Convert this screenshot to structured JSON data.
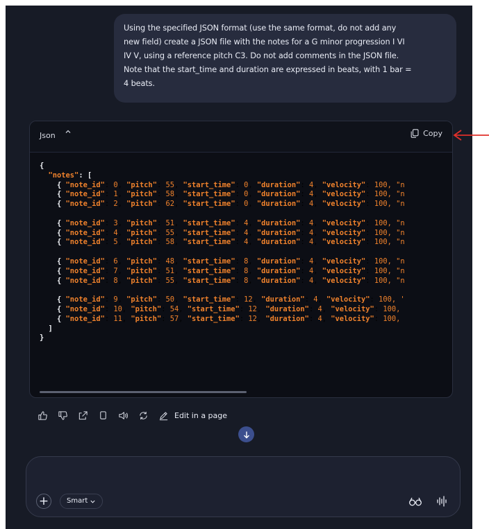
{
  "user_message": "Using the specified JSON format (use the same format, do not add any\nnew field) create a JSON file with the notes for a G minor progression I VI\nIV V, using a reference pitch C3. Do not add comments in the JSON file.\nNote that the start_time and duration are expressed in beats, with 1 bar =\n4 beats.",
  "code_block": {
    "language_label": "Json",
    "copy_label": "Copy",
    "root_open": "{",
    "notes_key": "\"notes\"",
    "notes_open": ": [",
    "groups": [
      [
        {
          "note_id": "0",
          "pitch": "55",
          "start_time": "0",
          "duration": "4",
          "velocity": "100",
          "tail": ", \"n"
        },
        {
          "note_id": "1",
          "pitch": "58",
          "start_time": "0",
          "duration": "4",
          "velocity": "100",
          "tail": ", \"n"
        },
        {
          "note_id": "2",
          "pitch": "62",
          "start_time": "0",
          "duration": "4",
          "velocity": "100",
          "tail": ", \"n"
        }
      ],
      [
        {
          "note_id": "3",
          "pitch": "51",
          "start_time": "4",
          "duration": "4",
          "velocity": "100",
          "tail": ", \"n"
        },
        {
          "note_id": "4",
          "pitch": "55",
          "start_time": "4",
          "duration": "4",
          "velocity": "100",
          "tail": ", \"n"
        },
        {
          "note_id": "5",
          "pitch": "58",
          "start_time": "4",
          "duration": "4",
          "velocity": "100",
          "tail": ", \"n"
        }
      ],
      [
        {
          "note_id": "6",
          "pitch": "48",
          "start_time": "8",
          "duration": "4",
          "velocity": "100",
          "tail": ", \"n"
        },
        {
          "note_id": "7",
          "pitch": "51",
          "start_time": "8",
          "duration": "4",
          "velocity": "100",
          "tail": ", \"n"
        },
        {
          "note_id": "8",
          "pitch": "55",
          "start_time": "8",
          "duration": "4",
          "velocity": "100",
          "tail": ", \"n"
        }
      ],
      [
        {
          "note_id": "9",
          "pitch": "50",
          "start_time": "12",
          "duration": "4",
          "velocity": "100",
          "tail": ", '"
        },
        {
          "note_id": "10",
          "pitch": "54",
          "start_time": "12",
          "duration": "4",
          "velocity": "100",
          "tail": ","
        },
        {
          "note_id": "11",
          "pitch": "57",
          "start_time": "12",
          "duration": "4",
          "velocity": "100",
          "tail": ","
        }
      ]
    ],
    "notes_close": "]",
    "root_close": "}"
  },
  "actions": {
    "icons": [
      "thumbs-up-icon",
      "thumbs-down-icon",
      "share-icon",
      "copy-icon",
      "speaker-icon",
      "regenerate-icon",
      "edit-pen-icon"
    ],
    "edit_label": "Edit in a page"
  },
  "composer": {
    "placeholder": "",
    "mode_label": "Smart"
  },
  "colors": {
    "background": "#171b26",
    "bubble": "#272c3e",
    "code_key": "#f0822c",
    "accent_button": "#3c4f8e",
    "annotation_arrow": "#e0302a"
  }
}
